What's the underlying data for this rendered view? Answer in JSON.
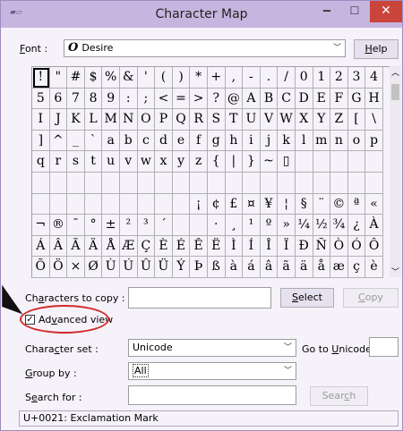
{
  "window": {
    "title": "Character Map",
    "app_icon": "character-map-icon",
    "minimize_glyph": "‒",
    "maximize_glyph": "☐",
    "close_glyph": "✕"
  },
  "font": {
    "label": "Font :",
    "label_underline": "F",
    "label_rest": "ont :",
    "glyph": "O",
    "value": "Desire",
    "help_label": "Help",
    "help_underline": "H",
    "help_rest": "elp"
  },
  "grid": {
    "rows": [
      [
        "!",
        "\"",
        "#",
        "$",
        "%",
        "&",
        "'",
        "(",
        ")",
        "*",
        "+",
        ",",
        "-",
        ".",
        "/",
        "0",
        "1",
        "2",
        "3",
        "4"
      ],
      [
        "5",
        "6",
        "7",
        "8",
        "9",
        ":",
        ";",
        "<",
        "=",
        ">",
        "?",
        "@",
        "A",
        "B",
        "C",
        "D",
        "E",
        "F",
        "G",
        "H"
      ],
      [
        "I",
        "J",
        "K",
        "L",
        "M",
        "N",
        "O",
        "P",
        "Q",
        "R",
        "S",
        "T",
        "U",
        "V",
        "W",
        "X",
        "Y",
        "Z",
        "[",
        "\\"
      ],
      [
        "]",
        "^",
        "_",
        "`",
        "a",
        "b",
        "c",
        "d",
        "e",
        "f",
        "g",
        "h",
        "i",
        "j",
        "k",
        "l",
        "m",
        "n",
        "o",
        "p"
      ],
      [
        "q",
        "r",
        "s",
        "t",
        "u",
        "v",
        "w",
        "x",
        "y",
        "z",
        "{",
        "|",
        "}",
        "~",
        "▯",
        "",
        "",
        "",
        "",
        ""
      ],
      [
        "",
        "",
        "",
        "",
        "",
        "",
        "",
        "",
        "",
        "",
        "",
        "",
        "",
        "",
        "",
        "",
        "",
        "",
        "",
        ""
      ],
      [
        "",
        "",
        "",
        "",
        "",
        "",
        "",
        "",
        "",
        "¡",
        "¢",
        "£",
        "¤",
        "¥",
        "¦",
        "§",
        "¨",
        "©",
        "ª",
        "«"
      ],
      [
        "¬",
        "®",
        "¯",
        "°",
        "±",
        "²",
        "³",
        "´",
        "",
        "",
        "·",
        "¸",
        "¹",
        "º",
        "»",
        "¼",
        "½",
        "¾",
        "¿",
        "À"
      ],
      [
        "Á",
        "Â",
        "Ã",
        "Ä",
        "Å",
        "Æ",
        "Ç",
        "È",
        "É",
        "Ê",
        "Ë",
        "Ì",
        "Í",
        "Î",
        "Ï",
        "Ð",
        "Ñ",
        "Ò",
        "Ó",
        "Ô"
      ],
      [
        "Õ",
        "Ö",
        "×",
        "Ø",
        "Ù",
        "Ú",
        "Û",
        "Ü",
        "Ý",
        "Þ",
        "ß",
        "à",
        "á",
        "â",
        "ã",
        "ä",
        "å",
        "æ",
        "ç",
        "è"
      ]
    ],
    "selected": "!"
  },
  "copy": {
    "label": "Characters to copy :",
    "label_pre": "Ch",
    "label_underline": "a",
    "label_rest": "racters to copy :",
    "value": "",
    "select_label": "Select",
    "select_underline": "S",
    "select_rest": "elect",
    "copy_label": "Copy",
    "copy_underline": "C",
    "copy_rest": "opy"
  },
  "advanced": {
    "label": "Advanced view",
    "label_pre": "Ad",
    "label_underline": "v",
    "label_rest": "anced view",
    "checked": true,
    "check_glyph": "✓"
  },
  "charset": {
    "label": "Character set :",
    "label_pre": "Chara",
    "label_underline": "c",
    "label_rest": "ter set :",
    "value": "Unicode",
    "goto_label": "Go to Unicode :",
    "goto_pre": "Go to ",
    "goto_underline": "U",
    "goto_rest": "nicode :",
    "goto_value": ""
  },
  "groupby": {
    "label": "Group by :",
    "label_underline": "G",
    "label_rest": "roup by :",
    "value": "All"
  },
  "search": {
    "label": "Search for :",
    "label_pre": "S",
    "label_underline": "e",
    "label_rest": "arch for :",
    "value": "",
    "button_label": "Search",
    "button_pre": "Sear",
    "button_underline": "c",
    "button_rest": "h"
  },
  "status": {
    "text": "U+0021: Exclamation Mark"
  }
}
